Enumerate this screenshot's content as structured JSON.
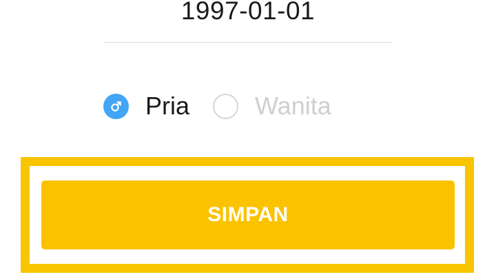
{
  "birth_date": {
    "value": "1997-01-01"
  },
  "gender": {
    "options": [
      {
        "label": "Pria",
        "selected": true,
        "icon": "male-icon"
      },
      {
        "label": "Wanita",
        "selected": false
      }
    ]
  },
  "save_button": {
    "label": "SIMPAN"
  },
  "colors": {
    "accent": "#42a5f5",
    "button": "#fbc200",
    "highlight": "#f9c400",
    "label_inactive": "#cfcfcf"
  }
}
